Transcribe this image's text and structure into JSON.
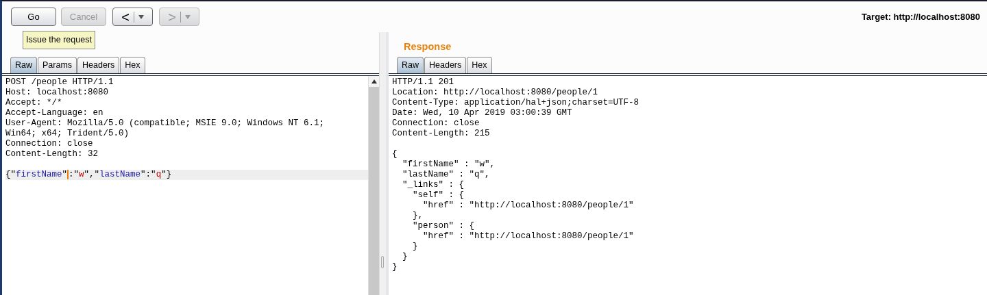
{
  "toolbar": {
    "buttons": [
      {
        "label": "Go",
        "kind": "text",
        "disabled": false
      },
      {
        "label": "Cancel",
        "kind": "text",
        "disabled": true
      },
      {
        "label": "<",
        "kind": "split",
        "disabled": false
      },
      {
        "label": ">",
        "kind": "split",
        "disabled": true
      }
    ],
    "tooltip": "Issue the request",
    "target": "Target: http://localhost:8080"
  },
  "request": {
    "tabs": [
      {
        "label": "Raw",
        "selected": true
      },
      {
        "label": "Params",
        "selected": false
      },
      {
        "label": "Headers",
        "selected": false
      },
      {
        "label": "Hex",
        "selected": false
      }
    ],
    "lines": [
      "POST /people HTTP/1.1",
      "Host: localhost:8080",
      "Accept: */*",
      "Accept-Language: en",
      "User-Agent: Mozilla/5.0 (compatible; MSIE 9.0; Windows NT 6.1;",
      "Win64; x64; Trident/5.0)",
      "Connection: close",
      "Content-Length: 32"
    ],
    "body": {
      "highlighted": true,
      "tokens": [
        {
          "text": "{\"",
          "kind": "punct"
        },
        {
          "text": "firstName",
          "kind": "key"
        },
        {
          "text": "\"",
          "kind": "punct"
        },
        {
          "text": ":\"",
          "kind": "punct",
          "caret": true
        },
        {
          "text": "w",
          "kind": "value"
        },
        {
          "text": "\",\"",
          "kind": "punct"
        },
        {
          "text": "lastName",
          "kind": "key"
        },
        {
          "text": "\":\"",
          "kind": "punct"
        },
        {
          "text": "q",
          "kind": "value"
        },
        {
          "text": "\"}",
          "kind": "punct"
        }
      ]
    }
  },
  "response": {
    "title": "Response",
    "tabs": [
      {
        "label": "Raw",
        "selected": true
      },
      {
        "label": "Headers",
        "selected": false
      },
      {
        "label": "Hex",
        "selected": false
      }
    ],
    "lines": [
      "HTTP/1.1 201",
      "Location: http://localhost:8080/people/1",
      "Content-Type: application/hal+json;charset=UTF-8",
      "Date: Wed, 10 Apr 2019 03:00:39 GMT",
      "Connection: close",
      "Content-Length: 215"
    ],
    "body_lines": [
      "{",
      "  \"firstName\" : \"w\",",
      "  \"lastName\" : \"q\",",
      "  \"_links\" : {",
      "    \"self\" : {",
      "      \"href\" : \"http://localhost:8080/people/1\"",
      "    },",
      "    \"person\" : {",
      "      \"href\" : \"http://localhost:8080/people/1\"",
      "    }",
      "  }",
      "}"
    ]
  }
}
